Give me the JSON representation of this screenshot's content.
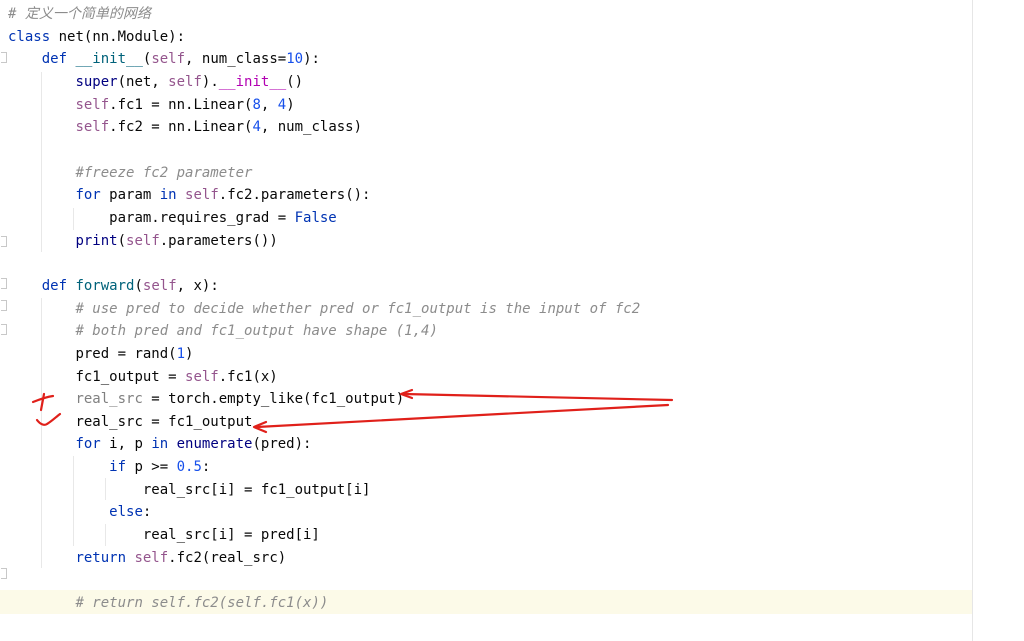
{
  "colors": {
    "keyword": "#0033b3",
    "function": "#00627a",
    "self": "#94558d",
    "number": "#1750eb",
    "magic": "#b200b2",
    "builtin": "#000080",
    "comment": "#8c8c8c",
    "annotation": "#e0201a",
    "current_line": "#fcfae8"
  },
  "code": {
    "l1_comment": "# 定义一个简单的网络",
    "l2_class": "class",
    "l2_name": "net",
    "l2_rest": "(nn.Module):",
    "l3_def": "def",
    "l3_name": "__init__",
    "l3_open": "(",
    "l3_self": "self",
    "l3_args": ", num_class=",
    "l3_num": "10",
    "l3_close": "):",
    "l4_super": "super",
    "l4_mid": "(net, ",
    "l4_self": "self",
    "l4_dot": ").",
    "l4_init": "__init__",
    "l4_end": "()",
    "l5_self": "self",
    "l5_mid": ".fc1 = nn.Linear(",
    "l5_n1": "8",
    "l5_comma": ", ",
    "l5_n2": "4",
    "l5_end": ")",
    "l6_self": "self",
    "l6_mid": ".fc2 = nn.Linear(",
    "l6_n1": "4",
    "l6_end": ", num_class)",
    "l8_comment": "#freeze fc2 parameter",
    "l9_for": "for",
    "l9_param": " param ",
    "l9_in": "in",
    "l9_self": "self",
    "l9_end": ".fc2.parameters():",
    "l10_text": "param.requires_grad = ",
    "l10_false": "False",
    "l11_print": "print",
    "l11_open": "(",
    "l11_self": "self",
    "l11_end": ".parameters())",
    "l13_def": "def",
    "l13_name": "forward",
    "l13_open": "(",
    "l13_self": "self",
    "l13_end": ", x):",
    "l14_comment": "# use pred to decide whether pred or fc1_output is the input of fc2",
    "l15_comment": "# both pred and fc1_output have shape (1,4)",
    "l16_text": "pred = rand(",
    "l16_num": "1",
    "l16_end": ")",
    "l17_text": "fc1_output = ",
    "l17_self": "self",
    "l17_end": ".fc1(x)",
    "l18_unused": "real_src",
    "l18_end": " = torch.empty_like(fc1_output)",
    "l19_text": "real_src = fc1_output",
    "l20_for": "for",
    "l20_mid": " i, p ",
    "l20_in": "in",
    "l20_sp": " ",
    "l20_enum": "enumerate",
    "l20_end": "(pred):",
    "l21_if": "if",
    "l21_mid": " p >= ",
    "l21_num": "0.5",
    "l21_end": ":",
    "l22_text": "real_src[i] = fc1_output[i]",
    "l23_else": "else",
    "l23_end": ":",
    "l24_text": "real_src[i] = pred[i]",
    "l25_return": "return",
    "l25_sp": " ",
    "l25_self": "self",
    "l25_end": ".fc2(real_src)",
    "l27_comment": "# return self.fc2(self.fc1(x))"
  }
}
